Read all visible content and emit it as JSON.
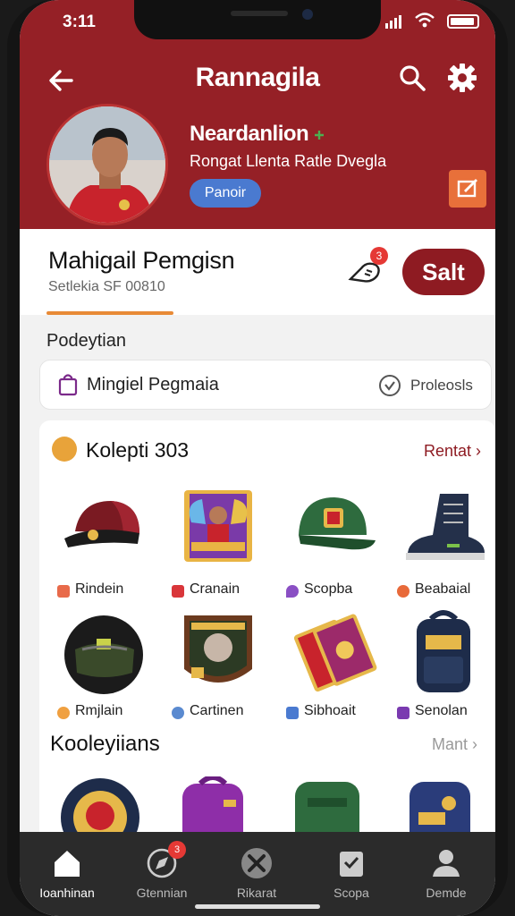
{
  "status": {
    "time": "3:11"
  },
  "topbar": {
    "title": "Rannagila"
  },
  "profile": {
    "name": "Neardanlion",
    "subtitle": "Rongat Llenta Ratle Dvegla",
    "pill": "Panoir"
  },
  "card": {
    "title": "Mahigail Pemgisn",
    "subtitle": "Setlekia SF 00810",
    "notif_count": "3",
    "sell_label": "Salt"
  },
  "section": {
    "label": "Podeytian"
  },
  "pick_row": {
    "left_label": "Mingiel Pegmaia",
    "right_label": "Proleosls"
  },
  "collection": {
    "title": "Kolepti 303",
    "link": "Rentat",
    "items": [
      {
        "name": "Rindein",
        "icon": "cap-icon"
      },
      {
        "name": "Cranain",
        "icon": "card-icon"
      },
      {
        "name": "Scopba",
        "icon": "hat-icon"
      },
      {
        "name": "Beabaial",
        "icon": "boot-icon"
      },
      {
        "name": "Rmjlain",
        "icon": "helmet-icon"
      },
      {
        "name": "Cartinen",
        "icon": "badge-icon"
      },
      {
        "name": "Sibhoait",
        "icon": "ticket-icon"
      },
      {
        "name": "Senolan",
        "icon": "backpack-icon"
      }
    ]
  },
  "section2": {
    "title": "Kooleyiians",
    "link": "Mant"
  },
  "tabs": [
    {
      "label": "Ioanhinan",
      "icon": "home-icon",
      "active": true
    },
    {
      "label": "Gtennian",
      "icon": "compass-icon",
      "badge": "3"
    },
    {
      "label": "Rikarat",
      "icon": "tools-icon"
    },
    {
      "label": "Scopa",
      "icon": "clipboard-icon"
    },
    {
      "label": "Demde",
      "icon": "person-icon"
    }
  ],
  "colors": {
    "brand": "#952026",
    "accent": "#e88a36",
    "tabbar": "#2b2b2b"
  }
}
